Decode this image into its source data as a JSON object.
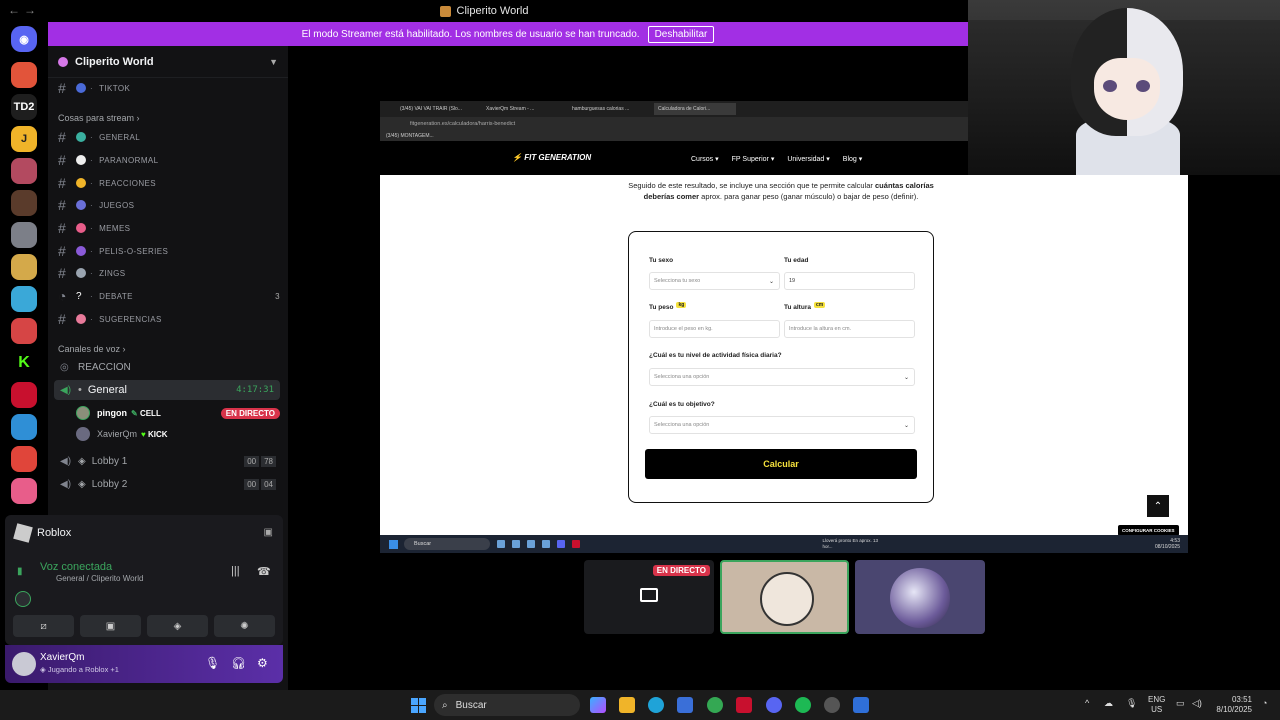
{
  "window": {
    "title": "Cliperito World"
  },
  "banner": {
    "text": "El modo Streamer está habilitado. Los nombres de usuario se han truncado.",
    "button": "Deshabilitar"
  },
  "rail": {
    "td2_label": "TD2",
    "j_label": "J",
    "k_label": "K"
  },
  "server": {
    "name": "Cliperito World"
  },
  "channels": {
    "tiktok": "TIKTOK",
    "category_stream": "Cosas para stream",
    "general": "GENERAL",
    "paranormal": "PARANORMAL",
    "reacciones": "REACCIONES",
    "juegos": "JUEGOS",
    "memes": "MEMES",
    "pelis": "PELIS-O-SERIES",
    "zings": "ZINGS",
    "debate": "DEBATE",
    "debate_count": "3",
    "sugerencias": "SUGERENCIAS"
  },
  "voice": {
    "category": "Canales de voz",
    "reaccion": "REACCION",
    "general": "General",
    "general_time": "4:17:31",
    "members": [
      {
        "name": "pingon",
        "tag": "CELL",
        "badge": "EN DIRECTO"
      },
      {
        "name": "XavierQm",
        "tag": "KICK"
      }
    ],
    "lobby1": "Lobby 1",
    "lobby1_counts": [
      "00",
      "78"
    ],
    "lobby2": "Lobby 2",
    "lobby2_counts": [
      "00",
      "04"
    ]
  },
  "panel": {
    "game": "Roblox",
    "status": "Voz conectada",
    "location": "General / Cliperito World"
  },
  "user": {
    "name": "XavierQm",
    "status": "Jugando a Roblox +1"
  },
  "browser": {
    "tabs": [
      "(3/45) VAI VAI TRAIR (Slo...",
      "XavierQm Stream - ...",
      "hamburguesas calorias ...",
      "Calculadora de Calori..."
    ],
    "url": "fitgeneration.es/calculadora/harris-benedict",
    "bookmark": "(3/45) MONTAGEM...",
    "logo": "FIT GENERATION",
    "nav": [
      "Cursos",
      "FP Superior",
      "Universidad",
      "Blog"
    ],
    "intro_pre": "Seguido de este resultado, se incluye una sección que te permite calcular",
    "intro_bold": "cuántas calorías deberías comer",
    "intro_post": "aprox. para ganar peso (ganar músculo) o bajar de peso (definir).",
    "sexo_label": "Tu sexo",
    "sexo_value": "Selecciona tu sexo",
    "edad_label": "Tu edad",
    "edad_value": "19",
    "peso_label": "Tu peso",
    "peso_unit": "kg",
    "peso_placeholder": "Introduce el peso en kg.",
    "altura_label": "Tu altura",
    "altura_unit": "cm",
    "altura_placeholder": "Introduce la altura en cm.",
    "actividad_label": "¿Cuál es tu nivel de actividad física diaria?",
    "actividad_value": "Selecciona una opción",
    "objetivo_label": "¿Cuál es tu objetivo?",
    "objetivo_value": "Selecciona una opción",
    "calc_button": "Calcular",
    "cookies": "CONFIGURAR COOKIES",
    "taskbar_search": "Buscar",
    "weather": "Lloverá pronto En aprox. 13 hor...",
    "clock_time": "4:53",
    "clock_date": "08/10/2025"
  },
  "thumbs": {
    "live": "EN DIRECTO"
  },
  "taskbar": {
    "search": "Buscar",
    "lang1": "ENG",
    "lang2": "US",
    "time": "03:51",
    "date": "8/10/2025"
  },
  "colors": {
    "accent": "#a22fe4",
    "green": "#3ba55d",
    "live": "#d8334a",
    "fitgen_yellow": "#f5e13c"
  }
}
